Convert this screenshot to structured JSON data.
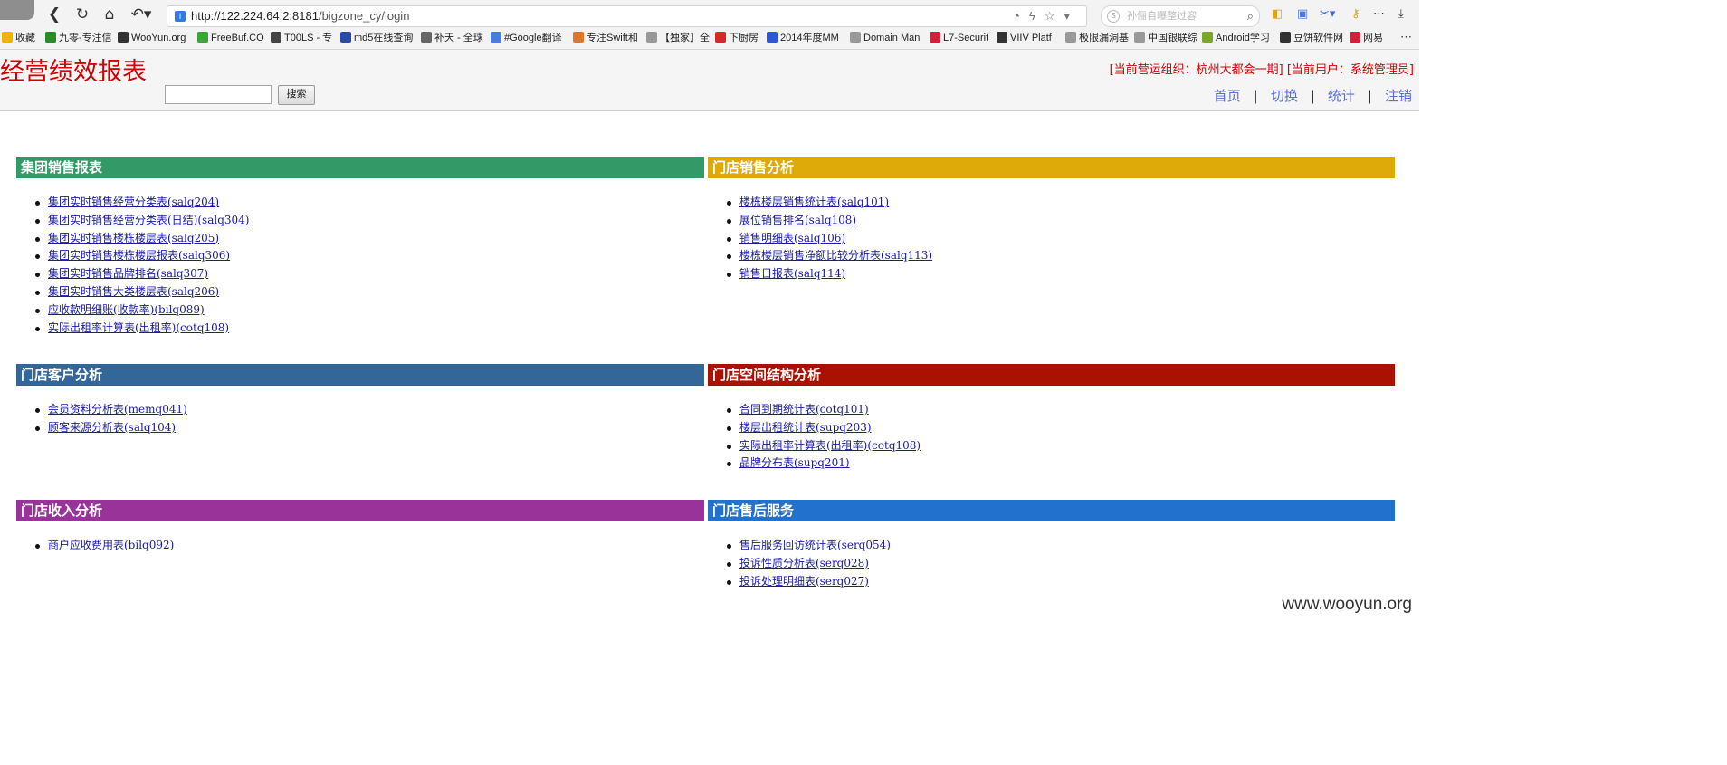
{
  "browser": {
    "url_domain": "http://122.224.64.2:8181",
    "url_path": "/bigzone_cy/login",
    "search_placeholder": "孙俪自曝整过容",
    "bookmarks": [
      {
        "label": "收藏",
        "icon": "star-icon",
        "color": "#f0b400"
      },
      {
        "label": "九零-专注信",
        "icon": "leaf-icon",
        "color": "#2a8a2a"
      },
      {
        "label": "WooYun.org",
        "icon": "wooyun-icon",
        "color": "#333333"
      },
      {
        "label": "FreeBuf.CO",
        "icon": "freebuf-icon",
        "color": "#3aa63a"
      },
      {
        "label": "T00LS - 专",
        "icon": "tools-icon",
        "color": "#444444"
      },
      {
        "label": "md5在线查询",
        "icon": "grid-icon",
        "color": "#2a4aa6"
      },
      {
        "label": "补天 - 全球",
        "icon": "butian-icon",
        "color": "#666666"
      },
      {
        "label": "#Google翻译",
        "icon": "translate-icon",
        "color": "#4a7be0"
      },
      {
        "label": "专注Swift和",
        "icon": "swift-icon",
        "color": "#e0762a"
      },
      {
        "label": "【独家】全",
        "icon": "page-icon",
        "color": "#999999"
      },
      {
        "label": "下厨房",
        "icon": "kitchen-icon",
        "color": "#d32a2a"
      },
      {
        "label": "2014年度MM",
        "icon": "play-icon",
        "color": "#2a5ad3"
      },
      {
        "label": "Domain Man",
        "icon": "page-icon",
        "color": "#999999"
      },
      {
        "label": "L7-Securit",
        "icon": "l7-icon",
        "color": "#d3203a"
      },
      {
        "label": "VIIV Platf",
        "icon": "code-icon",
        "color": "#333333"
      },
      {
        "label": "极限漏洞基",
        "icon": "page-icon",
        "color": "#999999"
      },
      {
        "label": "中国银联综",
        "icon": "page-icon",
        "color": "#999999"
      },
      {
        "label": "Android学习",
        "icon": "android-icon",
        "color": "#7aa62a"
      },
      {
        "label": "豆饼软件网",
        "icon": "doubing-icon",
        "color": "#333333"
      },
      {
        "label": "网易",
        "icon": "netease-icon",
        "color": "#d3203a"
      }
    ]
  },
  "header": {
    "title": "经营绩效报表",
    "search_button": "搜索",
    "org_info": "[当前营运组织：杭州大都会一期] [当前用户：系统管理员]",
    "nav": [
      "首页",
      "切换",
      "统计",
      "注销"
    ]
  },
  "panels": [
    {
      "title": "集团销售报表",
      "color": "#339966",
      "items": [
        "集团实时销售经营分类表(salq204)",
        "集团实时销售经营分类表(日结)(salq304)",
        "集团实时销售楼栋楼层表(salq205)",
        "集团实时销售楼栋楼层报表(salq306)",
        "集团实时销售品牌排名(salq307)",
        "集团实时销售大类楼层表(salq206)",
        "应收款明细账(收款率)(bilq089)",
        "实际出租率计算表(出租率)(cotq108)"
      ]
    },
    {
      "title": "门店销售分析",
      "color": "#ddaa0a",
      "items": [
        "楼栋楼层销售统计表(salq101)",
        "展位销售排名(salq108)",
        "销售明细表(salq106)",
        "楼栋楼层销售净额比较分析表(salq113)",
        "销售日报表(salq114)"
      ]
    },
    {
      "title": "门店客户分析",
      "color": "#336699",
      "items": [
        "会员资料分析表(memq041)",
        "顾客来源分析表(salq104)"
      ]
    },
    {
      "title": "门店空间结构分析",
      "color": "#aa1100",
      "items": [
        "合同到期统计表(cotq101)",
        "楼层出租统计表(supq203)",
        "实际出租率计算表(出租率)(cotq108)",
        "品牌分布表(supq201)"
      ]
    },
    {
      "title": "门店收入分析",
      "color": "#993399",
      "items": [
        "商户应收费用表(bilq092)"
      ]
    },
    {
      "title": "门店售后服务",
      "color": "#2271cc",
      "items": [
        "售后服务回访统计表(serq054)",
        "投诉性质分析表(serq028)",
        "投诉处理明细表(serq027)"
      ]
    }
  ],
  "watermark": "www.wooyun.org"
}
